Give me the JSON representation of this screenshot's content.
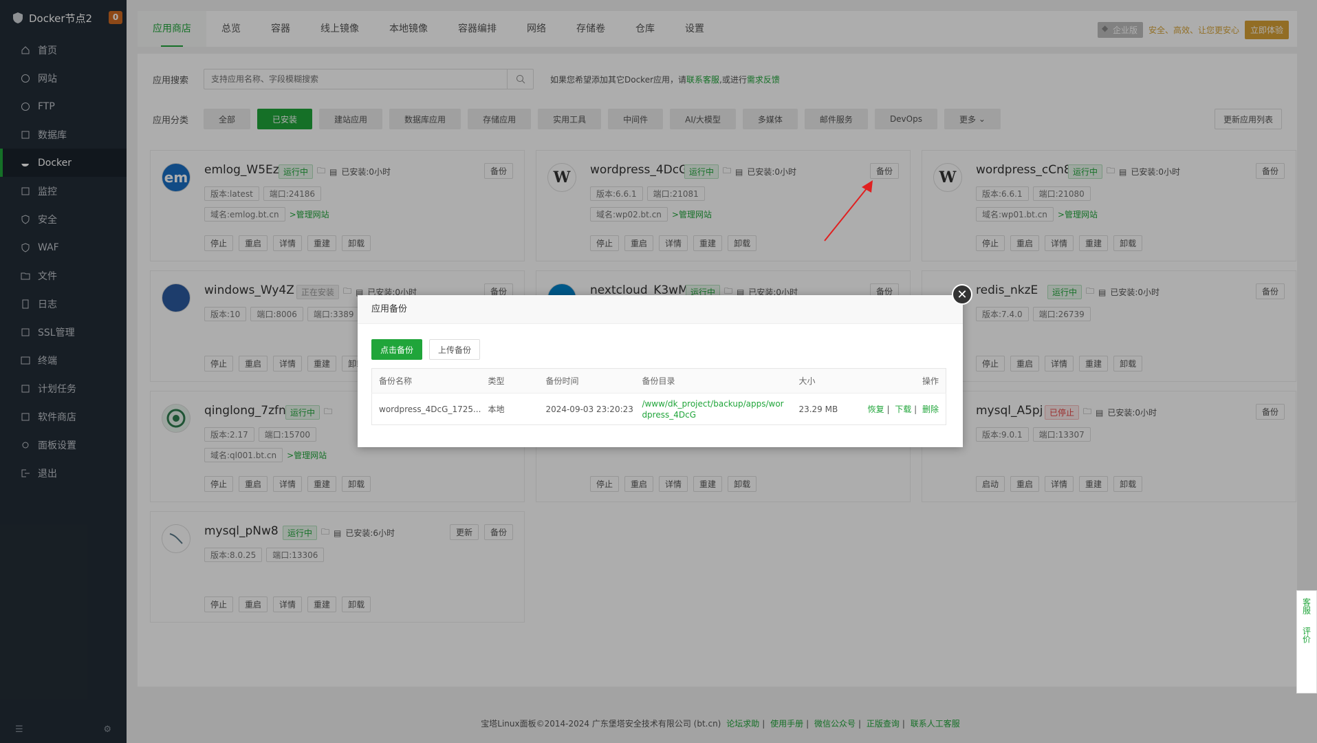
{
  "sidebar": {
    "title": "Docker节点2",
    "badge": "0",
    "items": [
      {
        "label": "首页"
      },
      {
        "label": "网站"
      },
      {
        "label": "FTP"
      },
      {
        "label": "数据库"
      },
      {
        "label": "Docker"
      },
      {
        "label": "监控"
      },
      {
        "label": "安全"
      },
      {
        "label": "WAF"
      },
      {
        "label": "文件"
      },
      {
        "label": "日志"
      },
      {
        "label": "SSL管理"
      },
      {
        "label": "终端"
      },
      {
        "label": "计划任务"
      },
      {
        "label": "软件商店"
      },
      {
        "label": "面板设置"
      },
      {
        "label": "退出"
      }
    ]
  },
  "topbar": {
    "tabs": [
      "应用商店",
      "总览",
      "容器",
      "线上镜像",
      "本地镜像",
      "容器编排",
      "网络",
      "存储卷",
      "仓库",
      "设置"
    ],
    "enterprise": "企业版",
    "slogan": "安全、高效、让您更安心",
    "try_button": "立即体验"
  },
  "search": {
    "label": "应用搜索",
    "placeholder": "支持应用名称、字段模糊搜索",
    "hint_prefix": "如果您希望添加其它Docker应用，请",
    "hint_link1": "联系客服",
    "hint_mid": ",或进行",
    "hint_link2": "需求反馈"
  },
  "category": {
    "label": "应用分类",
    "items": [
      "全部",
      "已安装",
      "建站应用",
      "数据库应用",
      "存储应用",
      "实用工具",
      "中间件",
      "AI/大模型",
      "多媒体",
      "邮件服务",
      "DevOps",
      "更多"
    ],
    "update_list": "更新应用列表"
  },
  "cards": [
    {
      "name": "emlog_W5Ez",
      "status": "运行中",
      "installed": "已安装:0小时",
      "version": "版本:latest",
      "port": "端口:24186",
      "domain": "域名:emlog.bt.cn",
      "manage": ">管理网站",
      "logo": "em"
    },
    {
      "name": "wordpress_4DcG",
      "status": "运行中",
      "installed": "已安装:0小时",
      "version": "版本:6.6.1",
      "port": "端口:21081",
      "domain": "域名:wp02.bt.cn",
      "manage": ">管理网站",
      "logo": "W"
    },
    {
      "name": "wordpress_cCn8",
      "status": "运行中",
      "installed": "已安装:0小时",
      "version": "版本:6.6.1",
      "port": "端口:21080",
      "domain": "域名:wp01.bt.cn",
      "manage": ">管理网站",
      "logo": "W"
    },
    {
      "name": "windows_Wy4Z",
      "status": "正在安装",
      "installed": "已安装:0小时",
      "version": "版本:10",
      "port": "端口:8006",
      "port2": "端口:3389",
      "logo": ""
    },
    {
      "name": "nextcloud_K3wM",
      "status": "运行中",
      "installed": "已安装:0小时",
      "logo": ""
    },
    {
      "name": "redis_nkzE",
      "status": "运行中",
      "installed": "已安装:0小时",
      "version": "版本:7.4.0",
      "port": "端口:26739",
      "logo": ""
    },
    {
      "name": "qinglong_7zfn",
      "status": "运行中",
      "installed": "",
      "version": "版本:2.17",
      "port": "端口:15700",
      "domain": "域名:ql001.bt.cn",
      "manage": ">管理网站",
      "logo": ""
    },
    {
      "name": "",
      "status": "",
      "installed": "",
      "logo": ""
    },
    {
      "name": "mysql_A5pj",
      "status": "已停止",
      "installed": "已安装:0小时",
      "version": "版本:9.0.1",
      "port": "端口:13307",
      "logo": ""
    },
    {
      "name": "mysql_pNw8",
      "status": "运行中",
      "installed": "已安装:6小时",
      "version": "版本:8.0.25",
      "port": "端口:13306",
      "update": "更新",
      "logo": ""
    }
  ],
  "card_actions": {
    "stop": "停止",
    "start": "启动",
    "restart": "重启",
    "detail": "详情",
    "rebuild": "重建",
    "uninstall": "卸载",
    "backup": "备份"
  },
  "modal": {
    "title": "应用备份",
    "btn_backup": "点击备份",
    "btn_upload": "上传备份",
    "headers": [
      "备份名称",
      "类型",
      "备份时间",
      "备份目录",
      "大小",
      "操作"
    ],
    "rows": [
      {
        "name": "wordpress_4DcG_1725...",
        "type": "本地",
        "time": "2024-09-03 23:20:23",
        "dir": "/www/dk_project/backup/apps/wordpress_4DcG",
        "size": "23.29 MB",
        "ops": [
          "恢复",
          "下载",
          "删除"
        ]
      }
    ]
  },
  "float": {
    "service": "客服",
    "rate": "评价"
  },
  "footer": {
    "copy": "宝塔Linux面板©2014-2024 广东堡塔安全技术有限公司 (bt.cn)",
    "links": [
      "论坛求助",
      "使用手册",
      "微信公众号",
      "正版查询",
      "联系人工客服"
    ]
  }
}
